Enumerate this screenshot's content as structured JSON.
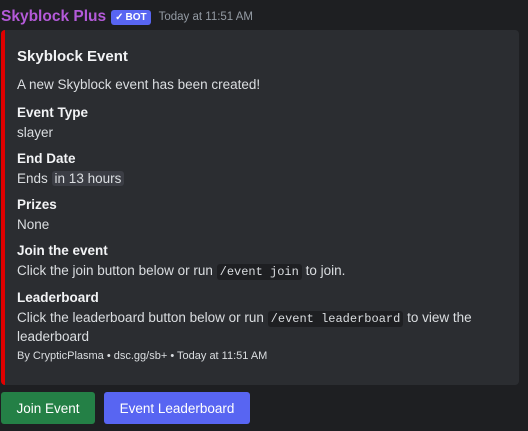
{
  "message": {
    "author": "Skyblock Plus",
    "bot_badge": {
      "check_icon": "check-icon",
      "label": "BOT"
    },
    "timestamp": "Today at 11:51 AM"
  },
  "embed": {
    "accent_color": "#e00000",
    "title": "Skyblock Event",
    "description": "A new Skyblock event has been created!",
    "fields": {
      "event_type": {
        "name": "Event Type",
        "value": "slayer"
      },
      "end_date": {
        "name": "End Date",
        "prefix": "Ends",
        "relative_time": "in 13 hours"
      },
      "prizes": {
        "name": "Prizes",
        "value": "None"
      },
      "join": {
        "name": "Join the event",
        "text_before": "Click the join button below or run",
        "command": "/event join",
        "text_after": "to join."
      },
      "leaderboard": {
        "name": "Leaderboard",
        "text_before": "Click the leaderboard button below or run",
        "command": "/event leaderboard",
        "text_after": "to view the leaderboard"
      }
    },
    "footer": "By CrypticPlasma • dsc.gg/sb+ • Today at 11:51 AM"
  },
  "buttons": {
    "join": {
      "label": "Join Event",
      "color": "#248046"
    },
    "leaderboard": {
      "label": "Event Leaderboard",
      "color": "#5865f2"
    }
  },
  "colors": {
    "background": "#1e1f22",
    "embed_background": "#2b2d31",
    "author": "#b45ad9",
    "bot_badge": "#5865f2"
  }
}
